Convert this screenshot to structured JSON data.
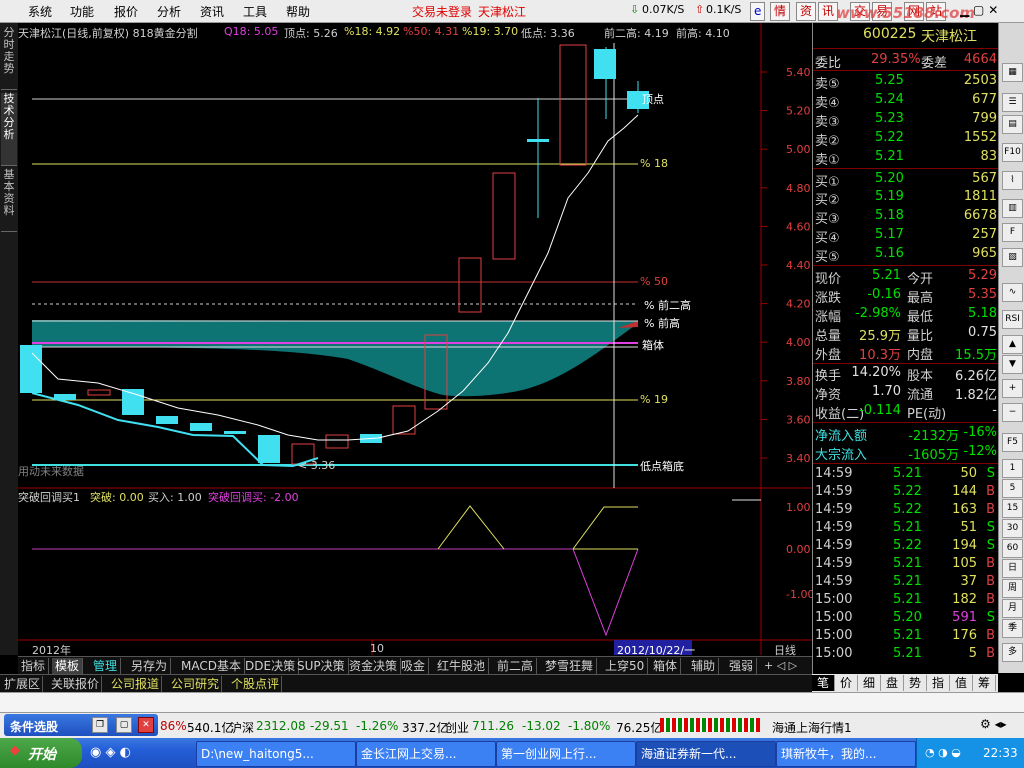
{
  "menu": {
    "items": [
      "系统",
      "功能",
      "报价",
      "分析",
      "资讯",
      "工具",
      "帮助"
    ],
    "notice": "交易未登录",
    "stock": "天津松江",
    "speed_down": "0.07K/S",
    "speed_up": "0.1K/S",
    "buttons": [
      "情",
      "资",
      "讯",
      "交",
      "易",
      "网",
      "站"
    ],
    "watermark": "www.55188.com"
  },
  "side_tabs": [
    "分时走势",
    "技术分析",
    "基本资料"
  ],
  "chart": {
    "title": "天津松江(日线,前复权) 818黄金分割",
    "q18": "Q18: 5.05",
    "top": "顶点: 5.26",
    "p18": "%18: 4.92",
    "p50": "%50: 4.31",
    "p19": "%19: 3.70",
    "low": "低点: 3.36",
    "prev2high": "前二高: 4.19",
    "prevhigh": "前高: 4.10",
    "price_ticks": [
      "5.40",
      "5.20",
      "5.00",
      "4.80",
      "4.60",
      "4.40",
      "4.20",
      "4.00",
      "3.80",
      "3.60",
      "3.40"
    ],
    "line_labels": {
      "top": "顶点",
      "p18": "% 18",
      "p50": "% 50",
      "prev2": "% 前二高",
      "prev": "% 前高",
      "box": "箱体",
      "p19": "% 19",
      "bottom": "低点箱底"
    },
    "low_note": "< 3.36",
    "future_note": "用动未来数据",
    "indicator_title": "突破回调买1",
    "ind_break": "突破: 0.00",
    "ind_buy": "买入: 1.00",
    "ind_pullback": "突破回调买: -2.00",
    "ind_ticks": [
      "1.00",
      "0.00",
      "-1.00"
    ],
    "date_left": "2012年",
    "date_mid": "10",
    "date_cursor": "2012/10/22/一",
    "period": "日线"
  },
  "quote": {
    "code": "600225",
    "name": "天津松江",
    "weibi_label": "委比",
    "weibi": "29.35%",
    "weicha_label": "委差",
    "weicha": "4664",
    "sell": [
      {
        "label": "卖⑤",
        "price": "5.25",
        "vol": "2503"
      },
      {
        "label": "卖④",
        "price": "5.24",
        "vol": "677"
      },
      {
        "label": "卖③",
        "price": "5.23",
        "vol": "799"
      },
      {
        "label": "卖②",
        "price": "5.22",
        "vol": "1552"
      },
      {
        "label": "卖①",
        "price": "5.21",
        "vol": "83"
      }
    ],
    "buy": [
      {
        "label": "买①",
        "price": "5.20",
        "vol": "567"
      },
      {
        "label": "买②",
        "price": "5.19",
        "vol": "1811"
      },
      {
        "label": "买③",
        "price": "5.18",
        "vol": "6678"
      },
      {
        "label": "买④",
        "price": "5.17",
        "vol": "257"
      },
      {
        "label": "买⑤",
        "price": "5.16",
        "vol": "965"
      }
    ],
    "stats": [
      {
        "l1": "现价",
        "v1": "5.21",
        "l2": "今开",
        "v2": "5.29"
      },
      {
        "l1": "涨跌",
        "v1": "-0.16",
        "l2": "最高",
        "v2": "5.35"
      },
      {
        "l1": "涨幅",
        "v1": "-2.98%",
        "l2": "最低",
        "v2": "5.18"
      },
      {
        "l1": "总量",
        "v1": "25.9万",
        "l2": "量比",
        "v2": "0.75"
      },
      {
        "l1": "外盘",
        "v1": "10.3万",
        "l2": "内盘",
        "v2": "15.5万"
      },
      {
        "l1": "换手",
        "v1": "14.20%",
        "l2": "股本",
        "v2": "6.26亿"
      },
      {
        "l1": "净资",
        "v1": "1.70",
        "l2": "流通",
        "v2": "1.82亿"
      },
      {
        "l1": "收益(二)",
        "v1": "-0.114",
        "l2": "PE(动)",
        "v2": "-"
      }
    ],
    "flow": [
      {
        "label": "净流入额",
        "val": "-2132万",
        "pct": "-16%"
      },
      {
        "label": "大宗流入",
        "val": "-1605万",
        "pct": "-12%"
      }
    ],
    "ticks": [
      {
        "t": "14:59",
        "p": "5.21",
        "v": "50",
        "d": "S"
      },
      {
        "t": "14:59",
        "p": "5.22",
        "v": "144",
        "d": "B"
      },
      {
        "t": "14:59",
        "p": "5.22",
        "v": "163",
        "d": "B"
      },
      {
        "t": "14:59",
        "p": "5.21",
        "v": "51",
        "d": "S"
      },
      {
        "t": "14:59",
        "p": "5.22",
        "v": "194",
        "d": "S"
      },
      {
        "t": "14:59",
        "p": "5.21",
        "v": "105",
        "d": "B"
      },
      {
        "t": "14:59",
        "p": "5.21",
        "v": "37",
        "d": "B"
      },
      {
        "t": "15:00",
        "p": "5.21",
        "v": "182",
        "d": "B"
      },
      {
        "t": "15:00",
        "p": "5.20",
        "v": "591",
        "d": "S"
      },
      {
        "t": "15:00",
        "p": "5.21",
        "v": "176",
        "d": "B"
      },
      {
        "t": "15:00",
        "p": "5.21",
        "v": "5",
        "d": "B"
      }
    ]
  },
  "bottom_tabs": [
    "指标",
    "模板",
    "管理",
    "另存为",
    "MACD基本",
    "DDE决策",
    "SUP决策",
    "资金决策",
    "吸金",
    "红牛股池",
    "前二高",
    "梦雪狂舞",
    "上穿50",
    "箱体",
    "辅助",
    "强弱"
  ],
  "bottom_tabs2": [
    "扩展区",
    "关联报价",
    "公司报道",
    "公司研究",
    "个股点评"
  ],
  "quote_tabs": [
    "笔",
    "价",
    "细",
    "盘",
    "势",
    "指",
    "值",
    "筹"
  ],
  "right_tools": [
    "F10",
    "RSI",
    "F5",
    "3",
    "15",
    "30",
    "60",
    "日",
    "周",
    "月",
    "多"
  ],
  "index_bar": {
    "panel_title": "条件选股",
    "prefix_pct": "86%",
    "sh_amount": "540.1亿",
    "sz_label": "沪深",
    "sz_value": "2312.08",
    "sz_change": "-29.51",
    "sz_pct": "-1.26%",
    "sz_amount": "337.2亿",
    "cy_label": "创业",
    "cy_value": "711.26",
    "cy_change": "-13.02",
    "cy_pct": "-1.80%",
    "cy_amount": "76.25亿",
    "market_label": "海通上海行情1"
  },
  "taskbar": {
    "start": "开始",
    "tasks": [
      "D:\\new_haitong5...",
      "金长江网上交易...",
      "第一创业网上行...",
      "海通证券新一代...",
      "琪新牧牛，我的..."
    ],
    "clock": "22:33"
  }
}
